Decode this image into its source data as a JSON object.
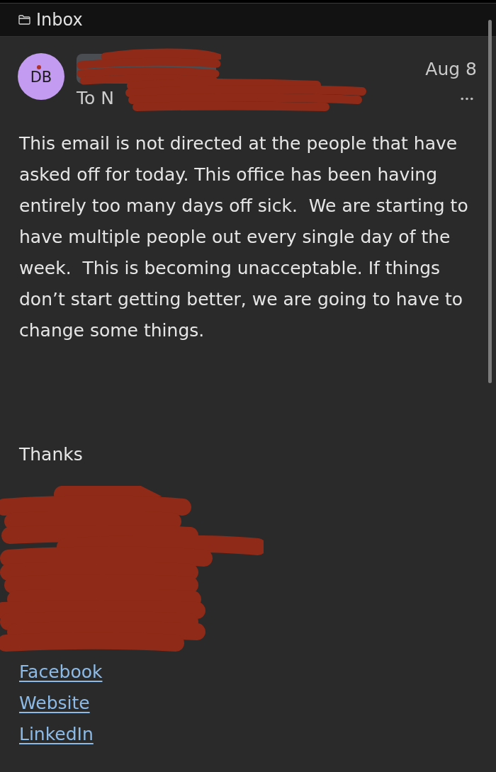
{
  "header": {
    "title": "Inbox"
  },
  "message": {
    "avatar": {
      "initials": "DB"
    },
    "sender": {
      "redacted": true
    },
    "recipient": {
      "prefix": "To N",
      "redacted": true
    },
    "date": "Aug 8"
  },
  "body": "This email is not directed at the people that have asked off for today. This office has been having entirely too many days off sick.  We are starting to have multiple people out every single day of the week.  This is becoming unacceptable. If things don’t start getting better, we are going to have to change some things.",
  "closing": "Thanks",
  "signature": {
    "redacted": true
  },
  "links": [
    "Facebook",
    "Website",
    "LinkedIn"
  ]
}
